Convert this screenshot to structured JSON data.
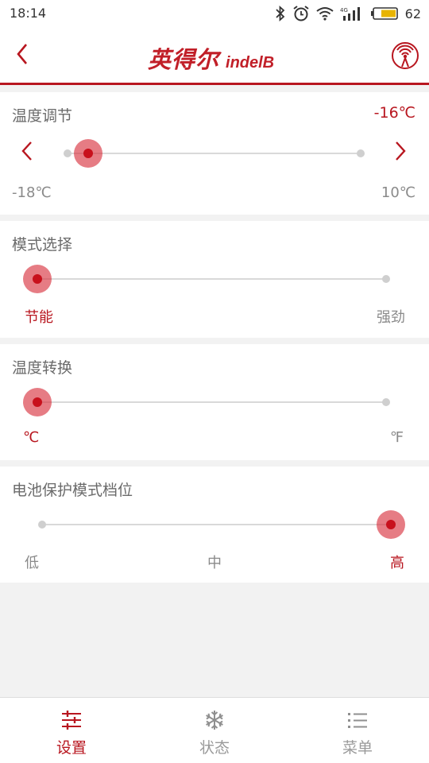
{
  "status_bar": {
    "time": "18:14",
    "network": "4G",
    "battery_level": "62",
    "icons": [
      "bluetooth-icon",
      "alarm-icon",
      "wifi-icon",
      "cellular-signal-icon",
      "battery-icon"
    ]
  },
  "header": {
    "logo_cn": "英得尔",
    "logo_en": "indelB",
    "icons": [
      "back-arrow-icon",
      "signal-broadcast-icon"
    ]
  },
  "colors": {
    "accent": "#b8161f",
    "thumb": "#c8101c",
    "track": "#d9d9d9",
    "background": "#f2f2f2"
  },
  "settings": {
    "temperature": {
      "title": "温度调节",
      "value": "-16℃",
      "min_label": "-18℃",
      "max_label": "10℃",
      "min": -18,
      "max": 10,
      "current": -16
    },
    "mode": {
      "title": "模式选择",
      "options": [
        "节能",
        "强劲"
      ],
      "selected": "节能"
    },
    "unit": {
      "title": "温度转换",
      "options": [
        "℃",
        "℉"
      ],
      "selected": "℃"
    },
    "battery_protection": {
      "title": "电池保护模式档位",
      "options": [
        "低",
        "中",
        "高"
      ],
      "selected": "高"
    }
  },
  "bottom_nav": {
    "items": [
      {
        "label": "设置",
        "icon": "sliders-icon",
        "active": true
      },
      {
        "label": "状态",
        "icon": "snowflake-icon",
        "active": false
      },
      {
        "label": "菜单",
        "icon": "list-icon",
        "active": false
      }
    ]
  }
}
